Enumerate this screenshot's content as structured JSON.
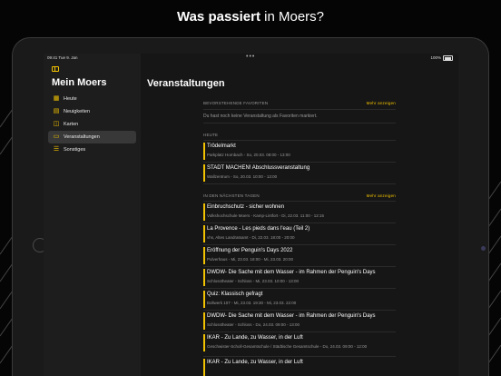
{
  "headline": {
    "bold": "Was passiert",
    "rest": " in Moers?"
  },
  "statusbar": {
    "time": "09:41  Tue 9. Jan",
    "dots": "•••",
    "right": "100%"
  },
  "sidebar": {
    "title": "Mein Moers",
    "items": [
      {
        "label": "Heute",
        "icon": "grid-icon",
        "glyph": "▦",
        "active": false
      },
      {
        "label": "Neuigkeiten",
        "icon": "news-icon",
        "glyph": "▤",
        "active": false
      },
      {
        "label": "Karten",
        "icon": "map-icon",
        "glyph": "◫",
        "active": false
      },
      {
        "label": "Veranstaltungen",
        "icon": "calendar-icon",
        "glyph": "▭",
        "active": true
      },
      {
        "label": "Sonstiges",
        "icon": "list-icon",
        "glyph": "☰",
        "active": false
      }
    ]
  },
  "main": {
    "title": "Veranstaltungen",
    "favorites": {
      "header": "BEVORSTEHENDE FAVORITEN",
      "link": "Mehr anzeigen",
      "empty": "Du hast noch keine Veranstaltung als Favoriten markiert."
    },
    "today": {
      "header": "HEUTE",
      "events": [
        {
          "title": "Trödelmarkt",
          "meta": "Parkplatz Hornbach - So, 20.03. 08:00 - 13:00"
        },
        {
          "title": "STADT MACHEN! Abschlussveranstaltung",
          "meta": "Wallzentrum - So, 20.03. 10:00 - 13:00"
        }
      ]
    },
    "upcoming": {
      "header": "IN DEN NÄCHSTEN TAGEN",
      "link": "Mehr anzeigen",
      "events": [
        {
          "title": "Einbruchschutz - sicher wohnen",
          "meta": "Volkshochschule Moers - Kamp-Lintfort - Di, 22.03. 11:00 - 12:15"
        },
        {
          "title": "La Provence - Les pieds dans l'eau (Teil 2)",
          "meta": "vhs, Altes Landratsamt - Di, 22.03. 18:00 - 20:00"
        },
        {
          "title": "Eröffnung der Penguin's Days 2022",
          "meta": "Pulverhaus - Mi, 23.03. 18:00 - Mi, 23.03. 20:00"
        },
        {
          "title": "DWDW- Die Sache mit dem Wasser - im Rahmen der Penguin's Days",
          "meta": "Schlosstheater - Schloss - Mi, 23.03. 10:00 - 13:00"
        },
        {
          "title": "Quiz: Klassisch gefragt",
          "meta": "Bollwerk 107 - Mi, 23.03. 19:30 - Mi, 23.03. 22:00"
        },
        {
          "title": "DWDW- Die Sache mit dem Wasser - im Rahmen der Penguin's Days",
          "meta": "Schlosstheater - Schloss - Do, 24.03. 09:00 - 13:00"
        },
        {
          "title": "IKAR - Zu Lande, zu Wasser, in der Luft",
          "meta": "Geschwister-Scholl-Gesamtschule / Städtische Gesamtschule - Do, 24.03. 09:00 - 12:00"
        },
        {
          "title": "IKAR - Zu Lande, zu Wasser, in der Luft",
          "meta": ""
        }
      ]
    }
  }
}
